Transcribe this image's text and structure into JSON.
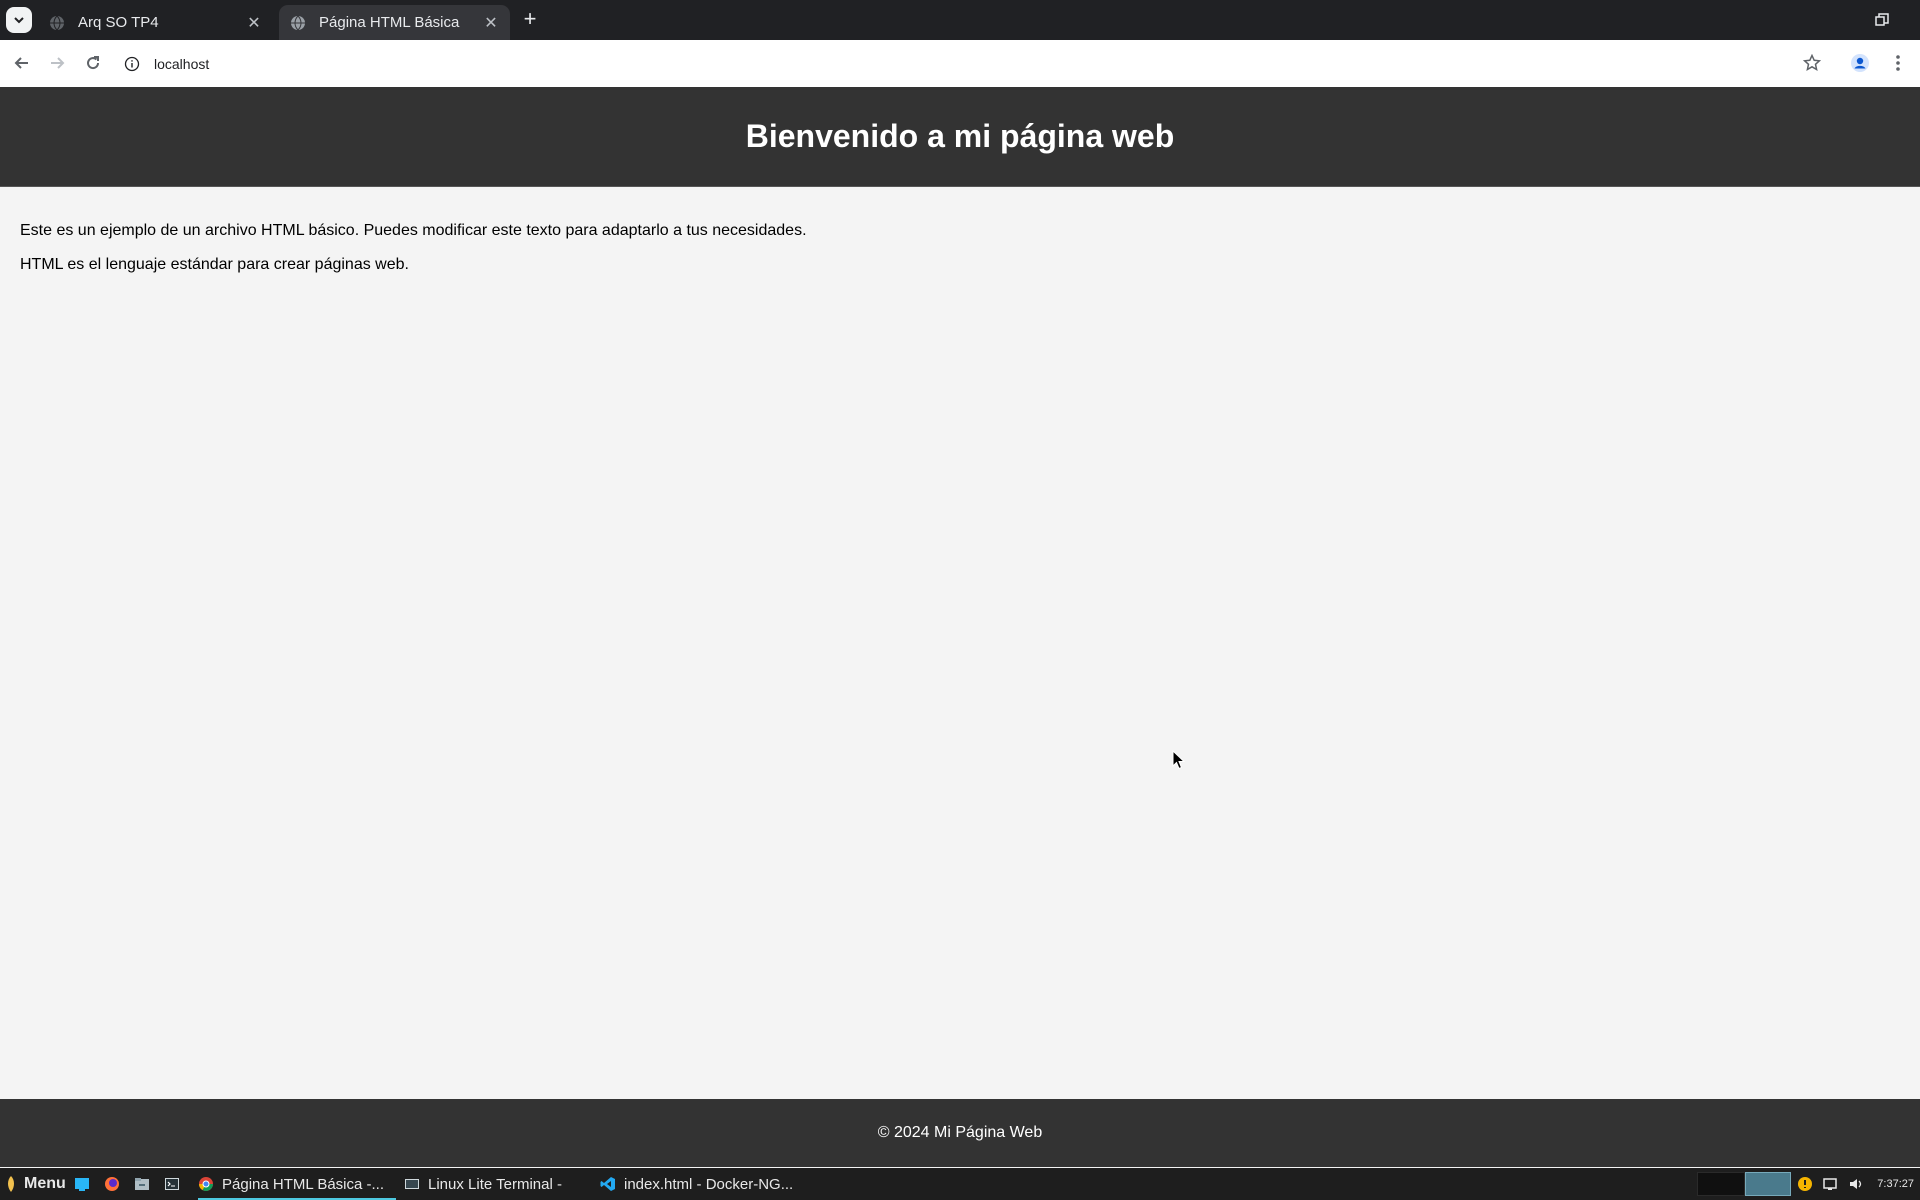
{
  "browser": {
    "tabs": [
      {
        "title": "Arq SO TP4",
        "active": false
      },
      {
        "title": "Página HTML Básica",
        "active": true
      }
    ],
    "address": "localhost"
  },
  "page": {
    "heading": "Bienvenido a mi página web",
    "paragraphs": [
      "Este es un ejemplo de un archivo HTML básico. Puedes modificar este texto para adaptarlo a tus necesidades.",
      "HTML es el lenguaje estándar para crear páginas web."
    ],
    "footer": "© 2024 Mi Página Web"
  },
  "taskbar": {
    "menu_label": "Menu",
    "windows": [
      {
        "title": "Página HTML Básica -...",
        "active": true,
        "icon": "chrome-icon"
      },
      {
        "title": "Linux Lite Terminal -",
        "active": false,
        "icon": "terminal-icon"
      },
      {
        "title": "index.html - Docker-NG...",
        "active": false,
        "icon": "vscode-icon"
      }
    ],
    "clock": "7:37:27"
  },
  "colors": {
    "page_header_bg": "#333333",
    "page_bg": "#f4f4f4",
    "tabstrip_bg": "#202124",
    "taskbar_bg": "#1e1e1e"
  }
}
